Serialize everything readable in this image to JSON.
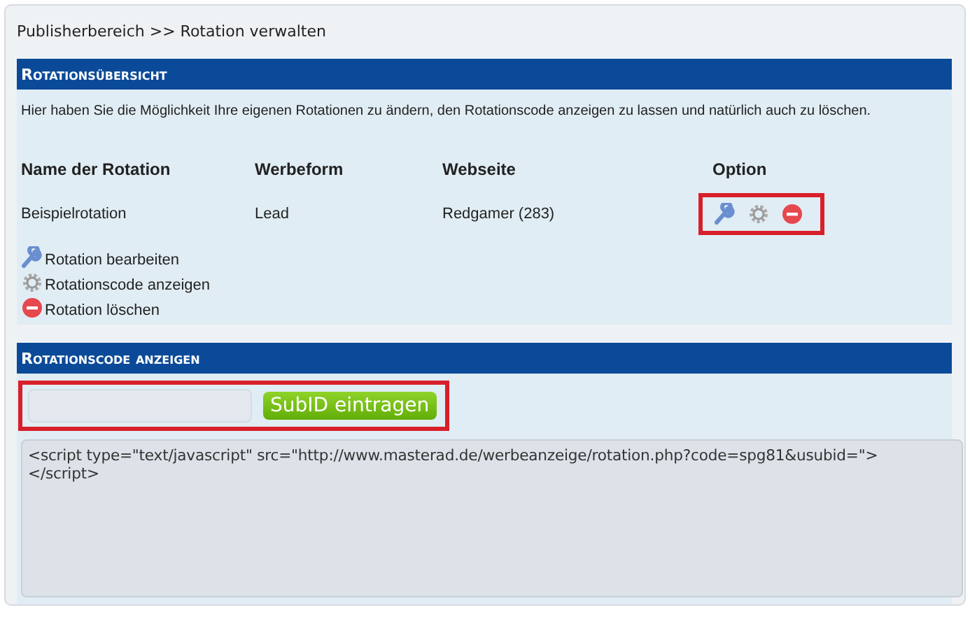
{
  "breadcrumb": "Publisherbereich >> Rotation verwalten",
  "overview": {
    "title": "Rotationsübersicht",
    "intro": "Hier haben Sie die Möglichkeit Ihre eigenen Rotationen zu ändern, den Rotationscode anzeigen zu lassen und natürlich auch zu löschen.",
    "columns": [
      "Name der Rotation",
      "Werbeform",
      "Webseite",
      "Option"
    ],
    "rows": [
      {
        "name": "Beispielrotation",
        "format": "Lead",
        "website": "Redgamer (283)",
        "options": [
          {
            "kind": "edit"
          },
          {
            "kind": "code"
          },
          {
            "kind": "delete"
          }
        ],
        "highlighted": true
      }
    ],
    "legend": [
      {
        "kind": "edit",
        "label": "Rotation bearbeiten"
      },
      {
        "kind": "code",
        "label": "Rotationscode anzeigen"
      },
      {
        "kind": "delete",
        "label": "Rotation löschen"
      }
    ]
  },
  "code_section": {
    "title": "Rotationscode anzeigen",
    "highlighted": true,
    "button": "SubID eintragen",
    "code": "<script type=\"text/javascript\" src=\"http://www.masterad.de/werbeanzeige/rotation.php?code=spg81&usubid=\">\n</script>"
  }
}
